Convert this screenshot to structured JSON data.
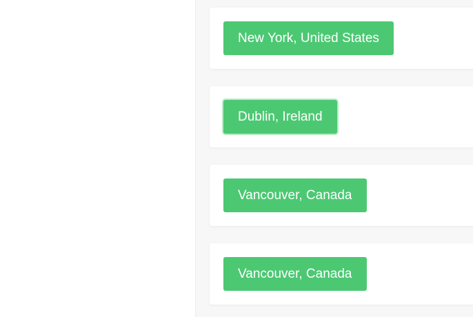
{
  "theme": {
    "accent": "#4cc873",
    "panel_bg": "#f7f7f8",
    "card_bg": "#ffffff"
  },
  "locations": [
    {
      "label": "New York, United States"
    },
    {
      "label": "Dublin, Ireland"
    },
    {
      "label": "Vancouver, Canada"
    },
    {
      "label": "Vancouver, Canada"
    }
  ]
}
